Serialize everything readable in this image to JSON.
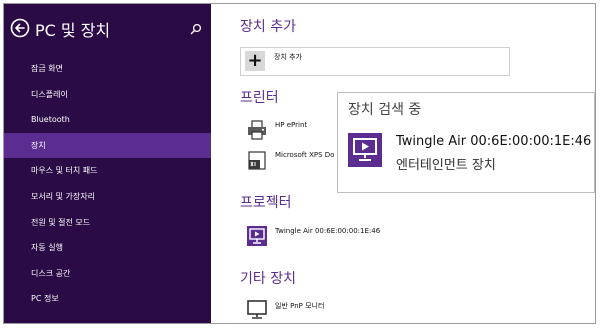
{
  "sidebar": {
    "title": "PC 및 장치",
    "items": [
      {
        "label": "잠금 화면"
      },
      {
        "label": "디스플레이"
      },
      {
        "label": "Bluetooth"
      },
      {
        "label": "장치",
        "active": true
      },
      {
        "label": "마우스 및 터치 패드"
      },
      {
        "label": "모서리 및 가장자리"
      },
      {
        "label": "전원 및 절전 모드"
      },
      {
        "label": "자동 실행"
      },
      {
        "label": "디스크 공간"
      },
      {
        "label": "PC 정보"
      }
    ]
  },
  "main": {
    "add_section": {
      "title": "장치 추가",
      "button_label": "장치 추가"
    },
    "printers": {
      "title": "프린터",
      "devices": [
        {
          "name": "HP ePrint",
          "icon": "printer-icon"
        },
        {
          "name": "Microsoft XPS Do",
          "icon": "xps-document-icon"
        }
      ]
    },
    "projectors": {
      "title": "프로젝터",
      "devices": [
        {
          "name": "Twingle Air 00:6E:00:00:1E:46",
          "icon": "projector-icon"
        }
      ]
    },
    "other": {
      "title": "기타 장치",
      "devices": [
        {
          "name": "일반 PnP 모니터",
          "icon": "monitor-icon"
        }
      ]
    }
  },
  "popup": {
    "title": "장치 검색 중",
    "device_name": "Twingle Air 00:6E:00:00:1E:46",
    "device_category": "엔터테인먼트 장치",
    "icon": "projector-icon"
  },
  "colors": {
    "sidebar_bg": "#2b0b45",
    "sidebar_active": "#5b2d91",
    "accent": "#5b2d91"
  }
}
